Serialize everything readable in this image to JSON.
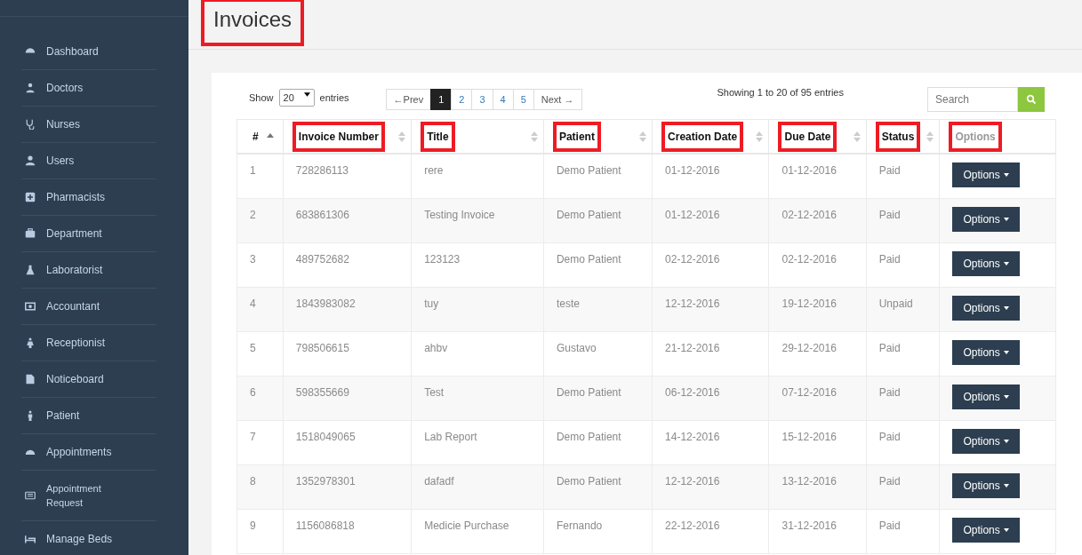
{
  "page_title": {
    "text": "Invoices",
    "highlighted": true
  },
  "sidebar": {
    "items": [
      {
        "label": "Dashboard"
      },
      {
        "label": "Doctors"
      },
      {
        "label": "Nurses"
      },
      {
        "label": "Users"
      },
      {
        "label": "Pharmacists"
      },
      {
        "label": "Department"
      },
      {
        "label": "Laboratorist"
      },
      {
        "label": "Accountant"
      },
      {
        "label": "Receptionist"
      },
      {
        "label": "Noticeboard"
      },
      {
        "label": "Patient"
      },
      {
        "label": "Appointments"
      },
      {
        "label": "Appointment Request"
      },
      {
        "label": "Manage Beds"
      }
    ]
  },
  "length_control": {
    "before": "Show",
    "value": "20",
    "after": "entries"
  },
  "pagination": [
    {
      "label": "←Prev",
      "selected": false
    },
    {
      "label": "1",
      "selected": true
    },
    {
      "label": "2",
      "selected": false
    },
    {
      "label": "3",
      "selected": false
    },
    {
      "label": "4",
      "selected": false
    },
    {
      "label": "5",
      "selected": false
    },
    {
      "label": "Next →",
      "selected": false
    }
  ],
  "info": "Showing 1 to 20 of 95 entries",
  "search": {
    "placeholder": "Search"
  },
  "table": {
    "columns": [
      {
        "label": "#",
        "sortable": true,
        "sorted_ascending": true,
        "highlighted": false
      },
      {
        "label": "Invoice Number",
        "sortable": true,
        "sorted_ascending": false,
        "highlighted": true
      },
      {
        "label": "Title",
        "sortable": true,
        "sorted_ascending": false,
        "highlighted": true
      },
      {
        "label": "Patient",
        "sortable": true,
        "sorted_ascending": false,
        "highlighted": true
      },
      {
        "label": "Creation Date",
        "sortable": true,
        "sorted_ascending": false,
        "highlighted": true
      },
      {
        "label": "Due Date",
        "sortable": true,
        "sorted_ascending": false,
        "highlighted": true
      },
      {
        "label": "Status",
        "sortable": true,
        "sorted_ascending": false,
        "highlighted": true
      },
      {
        "label": "Options",
        "sortable": false,
        "highlighted": true
      }
    ],
    "rows": [
      {
        "cells": [
          "1",
          "728286113",
          "rere",
          "Demo Patient",
          "01-12-2016",
          "01-12-2016",
          "Paid"
        ],
        "action": "Options"
      },
      {
        "cells": [
          "2",
          "683861306",
          "Testing Invoice",
          "Demo Patient",
          "01-12-2016",
          "02-12-2016",
          "Paid"
        ],
        "action": "Options"
      },
      {
        "cells": [
          "3",
          "489752682",
          "123123",
          "Demo Patient",
          "02-12-2016",
          "02-12-2016",
          "Paid"
        ],
        "action": "Options"
      },
      {
        "cells": [
          "4",
          "1843983082",
          "tuy",
          "teste",
          "12-12-2016",
          "19-12-2016",
          "Unpaid"
        ],
        "action": "Options"
      },
      {
        "cells": [
          "5",
          "798506615",
          "ahbv",
          "Gustavo",
          "21-12-2016",
          "29-12-2016",
          "Paid"
        ],
        "action": "Options"
      },
      {
        "cells": [
          "6",
          "598355669",
          "Test",
          "Demo Patient",
          "06-12-2016",
          "07-12-2016",
          "Paid"
        ],
        "action": "Options"
      },
      {
        "cells": [
          "7",
          "1518049065",
          "Lab Report",
          "Demo Patient",
          "14-12-2016",
          "15-12-2016",
          "Paid"
        ],
        "action": "Options"
      },
      {
        "cells": [
          "8",
          "1352978301",
          "dafadf",
          "Demo Patient",
          "12-12-2016",
          "13-12-2016",
          "Paid"
        ],
        "action": "Options"
      },
      {
        "cells": [
          "9",
          "1156086818",
          "Medicie Purchase",
          "Fernando",
          "22-12-2016",
          "31-12-2016",
          "Paid"
        ],
        "action": "Options"
      }
    ]
  }
}
